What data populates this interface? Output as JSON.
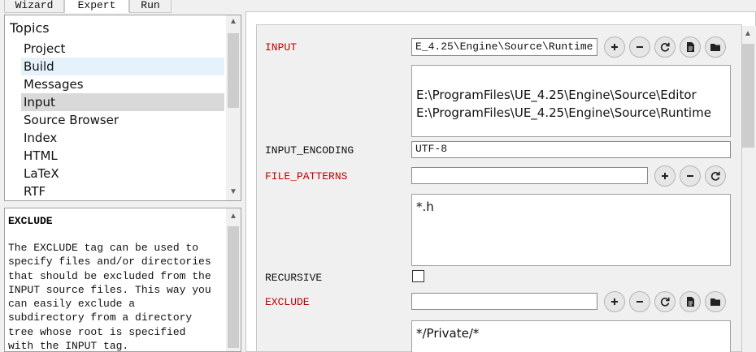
{
  "tabs": [
    "Wizard",
    "Expert",
    "Run"
  ],
  "topics": {
    "title": "Topics",
    "items": [
      "Project",
      "Build",
      "Messages",
      "Input",
      "Source Browser",
      "Index",
      "HTML",
      "LaTeX",
      "RTF"
    ]
  },
  "help": {
    "title": "EXCLUDE",
    "text": "The EXCLUDE tag can be used to\nspecify files and/or directories\nthat should be excluded from the\nINPUT source files. This way you\ncan easily exclude a\nsubdirectory from a directory\ntree whose root is specified\nwith the INPUT tag."
  },
  "settings": {
    "input": {
      "label": "INPUT",
      "value": "E_4.25\\Engine\\Source\\Runtime",
      "list": "E:\\ProgramFiles\\UE_4.25\\Engine\\Source\\Editor\nE:\\ProgramFiles\\UE_4.25\\Engine\\Source\\Runtime"
    },
    "input_encoding": {
      "label": "INPUT_ENCODING",
      "value": "UTF-8"
    },
    "file_patterns": {
      "label": "FILE_PATTERNS",
      "value": "",
      "list": "*.h"
    },
    "recursive": {
      "label": "RECURSIVE",
      "checked": false
    },
    "exclude": {
      "label": "EXCLUDE",
      "value": "",
      "list": "*/Private/*"
    }
  },
  "icons": [
    "plus-icon",
    "minus-icon",
    "refresh-icon",
    "file-icon",
    "folder-icon"
  ]
}
